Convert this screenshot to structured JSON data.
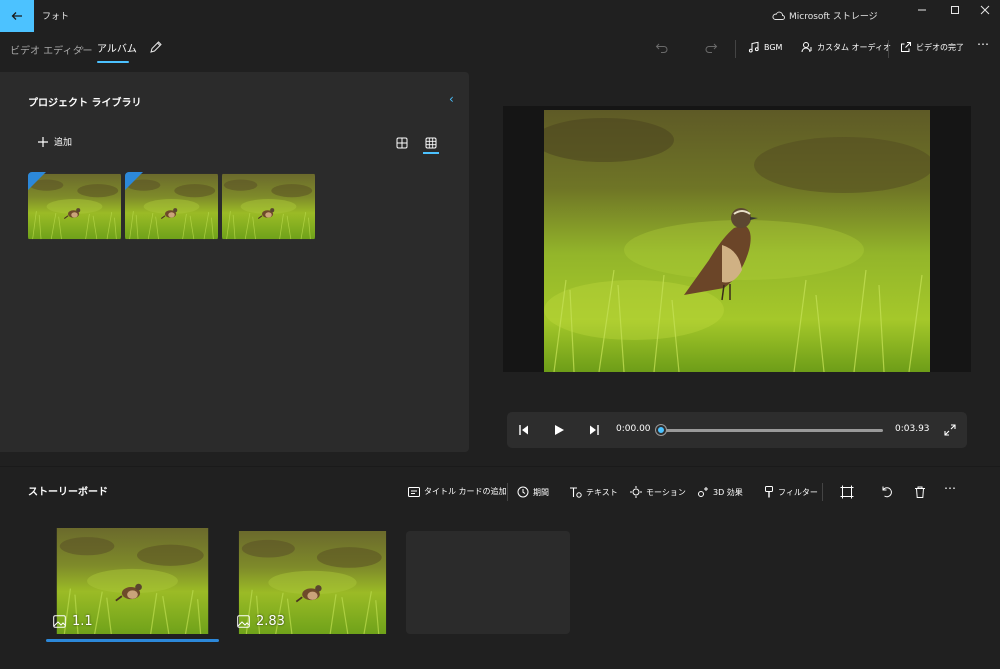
{
  "app": {
    "title": "フォト",
    "store_label": "Microsoft ストレージ"
  },
  "breadcrumb": {
    "root": "ビデオ エディター",
    "separator": "›",
    "current": "アルバム"
  },
  "toolbar": {
    "bgm": "BGM",
    "custom_audio": "カスタム オーディオ",
    "finish_video": "ビデオの完了"
  },
  "library": {
    "title": "プロジェクト ライブラリ",
    "add_label": "追加",
    "thumb_count": 3
  },
  "player": {
    "current_time": "0:00.00",
    "total_time": "0:03.93",
    "progress": 0.0
  },
  "storyboard": {
    "title": "ストーリーボード",
    "tools": {
      "title_card": "タイトル カードの追加",
      "duration": "期間",
      "text": "テキスト",
      "motion": "モーション",
      "effects_3d": "3D 効果",
      "filter": "フィルター"
    },
    "clips": [
      {
        "duration": "1.1",
        "selected": true
      },
      {
        "duration": "2.83",
        "selected": false
      }
    ]
  },
  "colors": {
    "accent": "#4cc2ff",
    "selection": "#2c88d9",
    "background": "#202020",
    "panel": "#2b2b2b"
  }
}
